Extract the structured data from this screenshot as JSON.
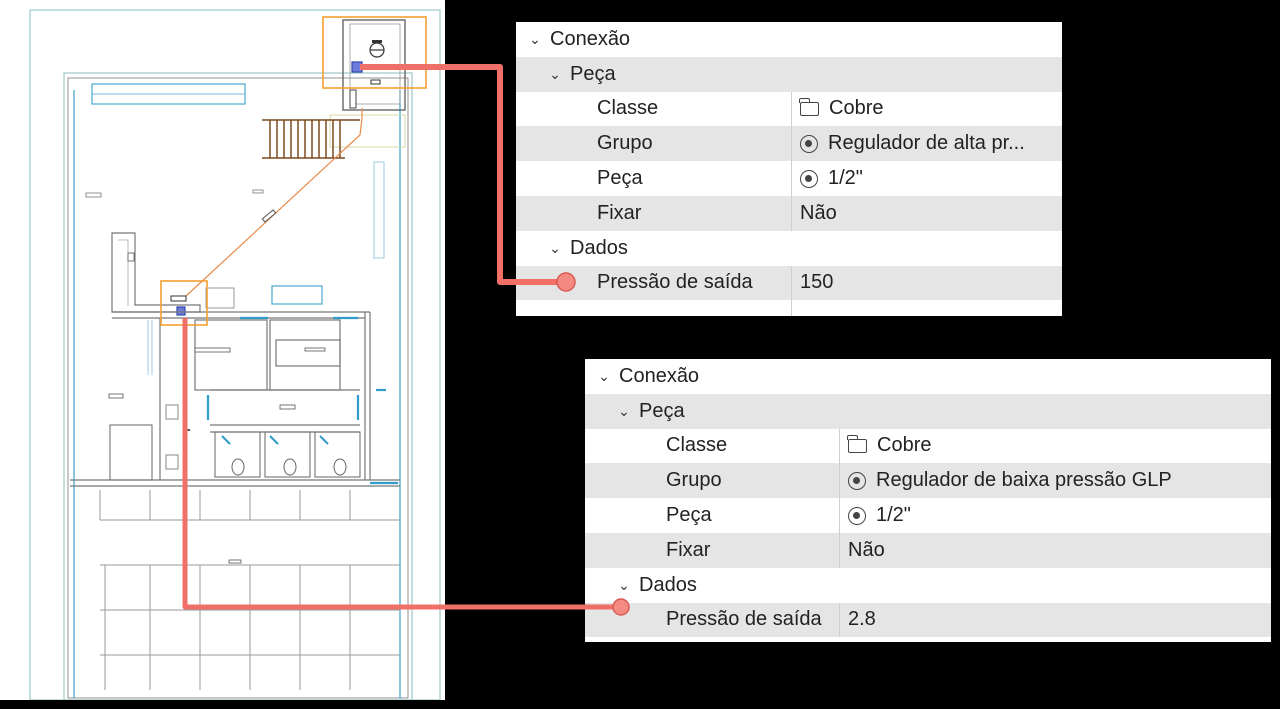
{
  "colors": {
    "connector": "#f07068",
    "highlight_box": "#f5a030",
    "row_shade": "#e5e5e5"
  },
  "floor_plan": {
    "icon": "floor-plan-drawing"
  },
  "panel_top": {
    "section": "Conexão",
    "subsection_piece": "Peça",
    "rows": [
      {
        "label": "Classe",
        "value": "Cobre",
        "icon": "folder-icon"
      },
      {
        "label": "Grupo",
        "value": "Regulador de alta pr...",
        "icon": "target-icon"
      },
      {
        "label": "Peça",
        "value": "1/2\"",
        "icon": "target-icon"
      },
      {
        "label": "Fixar",
        "value": "Não",
        "icon": ""
      }
    ],
    "subsection_data": "Dados",
    "data_rows": [
      {
        "label": "Pressão de saída",
        "value": "150"
      }
    ]
  },
  "panel_bottom": {
    "section": "Conexão",
    "subsection_piece": "Peça",
    "rows": [
      {
        "label": "Classe",
        "value": "Cobre",
        "icon": "folder-icon"
      },
      {
        "label": "Grupo",
        "value": "Regulador de baixa pressão GLP",
        "icon": "target-icon"
      },
      {
        "label": "Peça",
        "value": "1/2\"",
        "icon": "target-icon"
      },
      {
        "label": "Fixar",
        "value": "Não",
        "icon": ""
      }
    ],
    "subsection_data": "Dados",
    "data_rows": [
      {
        "label": "Pressão de saída",
        "value": "2.8"
      }
    ]
  }
}
